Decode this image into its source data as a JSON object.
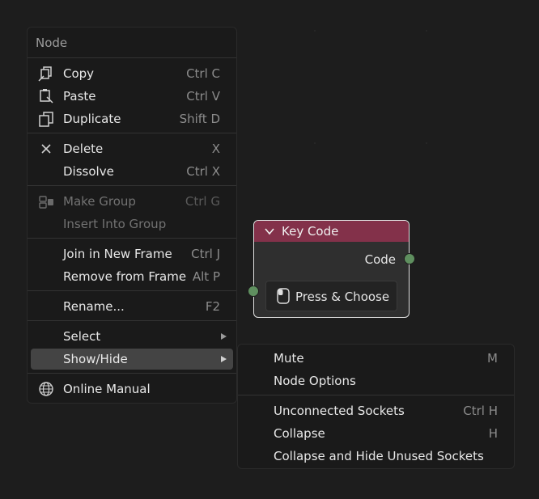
{
  "menu": {
    "title": "Node",
    "items": [
      {
        "label": "Copy",
        "shortcut": "Ctrl C",
        "icon": "copy-icon"
      },
      {
        "label": "Paste",
        "shortcut": "Ctrl V",
        "icon": "paste-icon"
      },
      {
        "label": "Duplicate",
        "shortcut": "Shift D",
        "icon": "duplicate-icon"
      },
      {
        "label": "Delete",
        "shortcut": "X",
        "icon": "close-icon"
      },
      {
        "label": "Dissolve",
        "shortcut": "Ctrl X"
      },
      {
        "label": "Make Group",
        "shortcut": "Ctrl G",
        "icon": "make-group-icon",
        "disabled": true
      },
      {
        "label": "Insert Into Group",
        "shortcut": "",
        "disabled": true
      },
      {
        "label": "Join in New Frame",
        "shortcut": "Ctrl J"
      },
      {
        "label": "Remove from Frame",
        "shortcut": "Alt P"
      },
      {
        "label": "Rename...",
        "shortcut": "F2"
      },
      {
        "label": "Select",
        "submenu": true
      },
      {
        "label": "Show/Hide",
        "submenu": true,
        "highlighted": true
      },
      {
        "label": "Online Manual",
        "icon": "globe-icon"
      }
    ]
  },
  "submenu": {
    "items": [
      {
        "label": "Mute",
        "shortcut": "M"
      },
      {
        "label": "Node Options",
        "shortcut": ""
      },
      {
        "label": "Unconnected Sockets",
        "shortcut": "Ctrl H"
      },
      {
        "label": "Collapse",
        "shortcut": "H"
      },
      {
        "label": "Collapse and Hide Unused Sockets",
        "shortcut": ""
      }
    ]
  },
  "node": {
    "title": "Key Code",
    "output_label": "Code",
    "button_label": "Press & Choose",
    "header_color": "#83314a",
    "socket_color": "#5f8f5f"
  }
}
